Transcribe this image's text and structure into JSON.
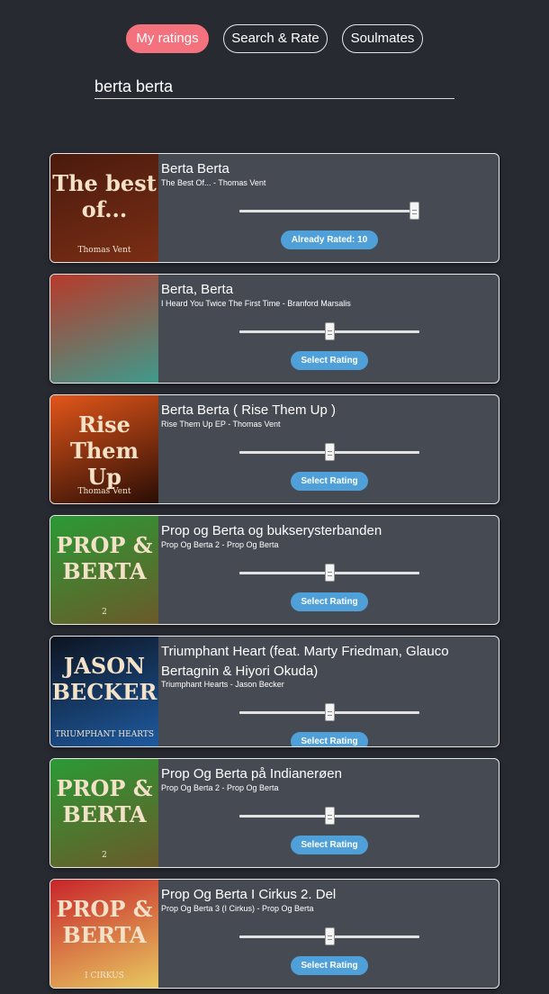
{
  "nav": {
    "my_ratings": "My ratings",
    "search_rate": "Search & Rate",
    "soulmates": "Soulmates"
  },
  "search": {
    "value": "berta berta"
  },
  "results": [
    {
      "title": "Berta Berta",
      "subtitle": "The Best Of... - Thomas Vent",
      "rating": 10,
      "button": "Already Rated: 10",
      "cover_colors": [
        "#4a1a0d",
        "#7a2e15"
      ],
      "cover_text": "The best of...",
      "cover_caption": "Thomas Vent"
    },
    {
      "title": "Berta, Berta",
      "subtitle": "I Heard You Twice The First Time - Branford Marsalis",
      "rating": 5,
      "button": "Select Rating",
      "cover_colors": [
        "#b83a2a",
        "#3f9a8c"
      ],
      "cover_text": "",
      "cover_caption": ""
    },
    {
      "title": "Berta Berta ( Rise Them Up )",
      "subtitle": "Rise Them Up EP - Thomas Vent",
      "rating": 5,
      "button": "Select Rating",
      "cover_colors": [
        "#e2561a",
        "#2a0d05"
      ],
      "cover_text": "Rise Them Up",
      "cover_caption": "Thomas Vent"
    },
    {
      "title": "Prop og Berta og bukserysterbanden",
      "subtitle": "Prop Og Berta 2 - Prop Og Berta",
      "rating": 5,
      "button": "Select Rating",
      "cover_colors": [
        "#2a9a35",
        "#6b5a2a"
      ],
      "cover_text": "PROP & BERTA",
      "cover_caption": "2"
    },
    {
      "title": "Triumphant Heart (feat. Marty Friedman, Glauco Bertagnin & Hiyori Okuda)",
      "subtitle": "Triumphant Hearts - Jason Becker",
      "rating": 5,
      "button": "Select Rating",
      "cover_colors": [
        "#0d1420",
        "#1e5aa0"
      ],
      "cover_text": "JASON BECKER",
      "cover_caption": "TRIUMPHANT HEARTS"
    },
    {
      "title": "Prop Og Berta på Indianerøen",
      "subtitle": "Prop Og Berta 2 - Prop Og Berta",
      "rating": 5,
      "button": "Select Rating",
      "cover_colors": [
        "#2a9a35",
        "#6b5a2a"
      ],
      "cover_text": "PROP & BERTA",
      "cover_caption": "2"
    },
    {
      "title": "Prop Og Berta I Cirkus 2. Del",
      "subtitle": "Prop Og Berta 3 (I Cirkus) - Prop Og Berta",
      "rating": 5,
      "button": "Select Rating",
      "cover_colors": [
        "#c8242a",
        "#e8c860"
      ],
      "cover_text": "PROP & BERTA",
      "cover_caption": "I CIRKUS"
    }
  ]
}
